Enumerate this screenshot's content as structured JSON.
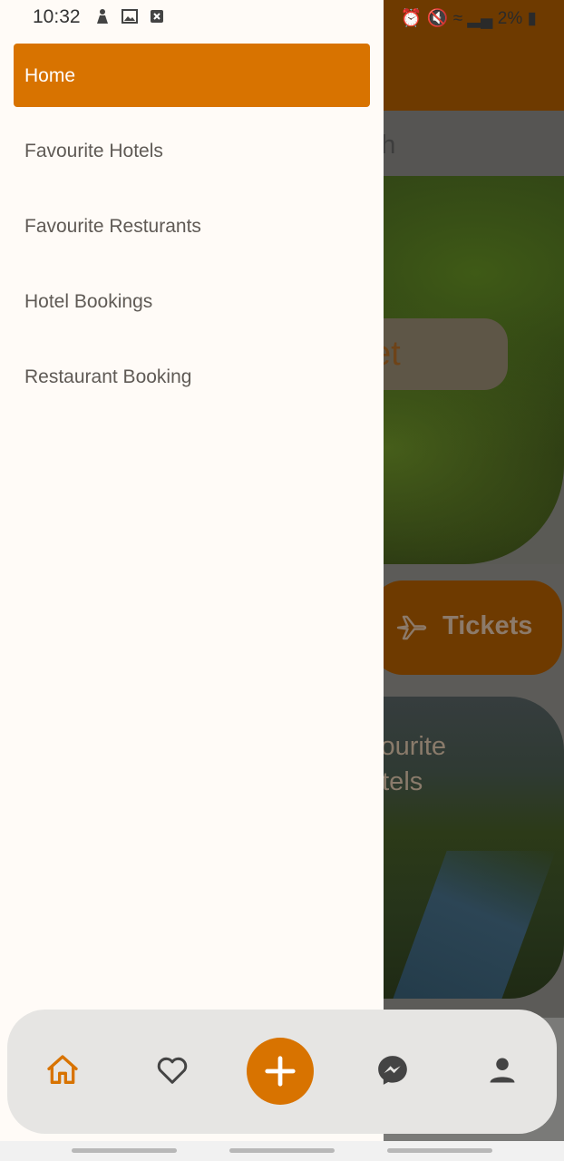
{
  "status_bar": {
    "time": "10:32",
    "battery": "2%",
    "icons": [
      "person-icon",
      "image-icon",
      "app-notif-icon",
      "alarm-icon",
      "mute-icon",
      "wifi-icon",
      "signal-icon",
      "battery-icon"
    ]
  },
  "background": {
    "search_placeholder": "arch",
    "budget_label": "et",
    "tickets_label": "Tickets",
    "card_title_line1": "vourite",
    "card_title_line2": "otels"
  },
  "drawer": {
    "items": [
      {
        "label": "Home",
        "active": true
      },
      {
        "label": "Favourite Hotels",
        "active": false
      },
      {
        "label": "Favourite Resturants",
        "active": false
      },
      {
        "label": "Hotel Bookings",
        "active": false
      },
      {
        "label": "Restaurant Booking",
        "active": false
      }
    ]
  },
  "bottom_nav": {
    "items": [
      "home-icon",
      "heart-icon",
      "add-icon",
      "messenger-icon",
      "profile-icon"
    ]
  },
  "colors": {
    "accent": "#d87300",
    "drawer_bg": "#fffbf7",
    "nav_bg": "#e6e5e3"
  }
}
